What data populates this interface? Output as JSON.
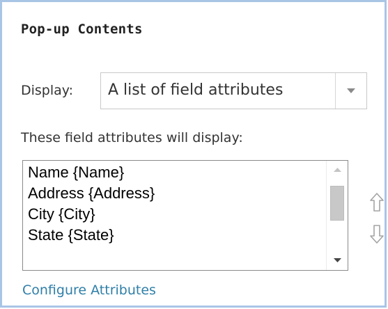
{
  "panel": {
    "title": "Pop-up Contents",
    "display_label": "Display:",
    "display_select": {
      "selected": "A list of field attributes"
    },
    "fields_label": "These field attributes will display:",
    "field_list": [
      {
        "label": "Name {Name}"
      },
      {
        "label": "Address {Address}"
      },
      {
        "label": "City {City}"
      },
      {
        "label": "State {State}"
      }
    ],
    "move_up_icon": "arrow-up-outline-icon",
    "move_down_icon": "arrow-down-outline-icon",
    "configure_link": "Configure Attributes"
  },
  "colors": {
    "panel_border": "#a9c5e6",
    "link": "#2f7fa8",
    "text": "#333333"
  }
}
